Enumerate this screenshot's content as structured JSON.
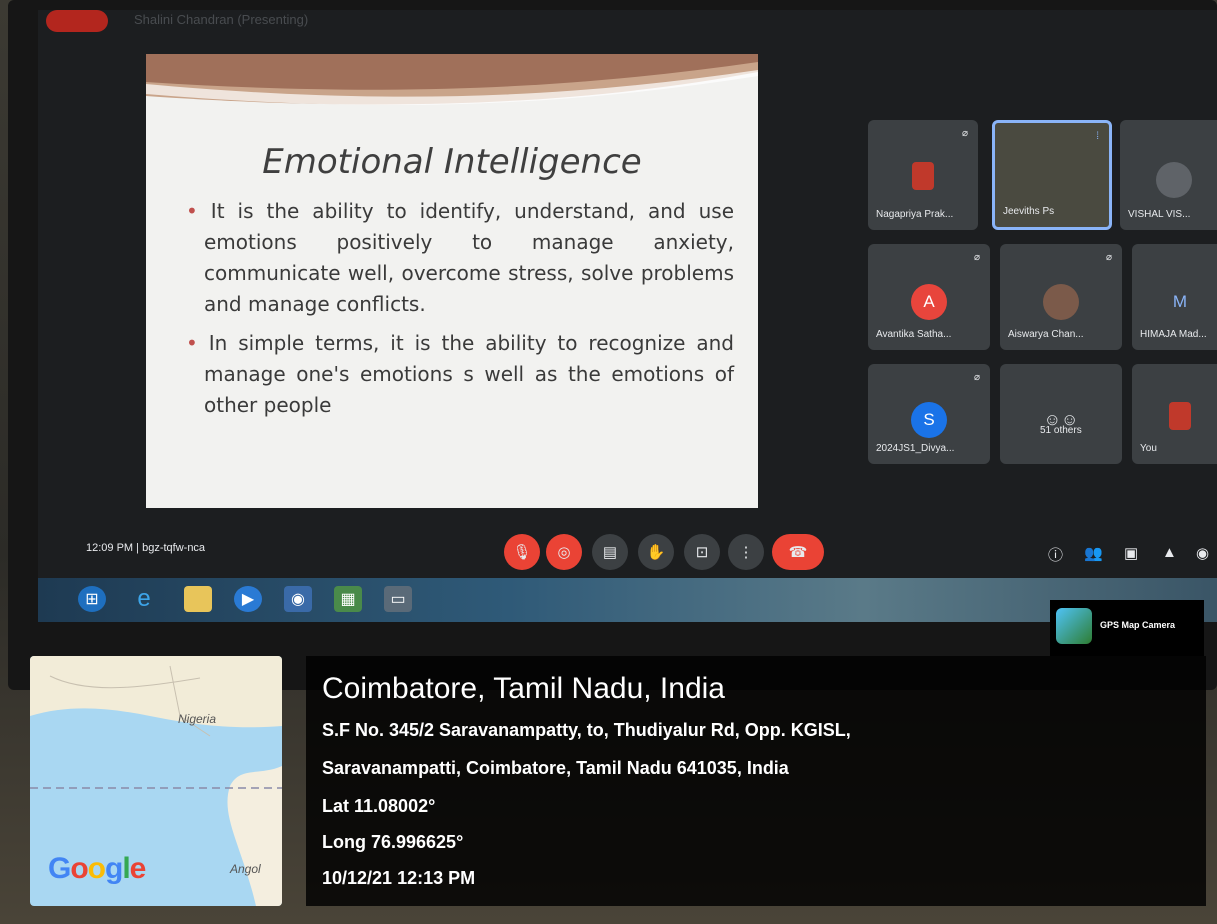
{
  "meet": {
    "rec_label": "REC",
    "presenting_label": "Shalini Chandran (Presenting)",
    "meeting_time": "12:09 PM",
    "meeting_code": "bgz-tqfw-nca",
    "participants": [
      {
        "name": "Nagapriya Prak...",
        "avatar_letter": "",
        "avatar_color": "#c0392b"
      },
      {
        "name": "Jeeviths Ps",
        "avatar_letter": "",
        "avatar_color": "#5f6368"
      },
      {
        "name": "VISHAL VIS...",
        "avatar_letter": "",
        "avatar_color": "#5f6368"
      },
      {
        "name": "Avantika Satha...",
        "avatar_letter": "A",
        "avatar_color": "#e8453c"
      },
      {
        "name": "Aiswarya Chan...",
        "avatar_letter": "",
        "avatar_color": "#7b5a4a"
      },
      {
        "name": "HIMAJA Mad...",
        "avatar_letter": "M",
        "avatar_color": "#5c6bc0"
      },
      {
        "name": "2024JS1_Divya...",
        "avatar_letter": "S",
        "avatar_color": "#1a73e8"
      },
      {
        "name": "51 others",
        "avatar_letter": "",
        "avatar_color": "#5f6368"
      },
      {
        "name": "You",
        "avatar_letter": "",
        "avatar_color": "#c0392b"
      }
    ]
  },
  "slide": {
    "title": "Emotional Intelligence",
    "bullets": [
      "It is the ability to identify, understand, and use emotions positively to manage anxiety, communicate well, overcome stress, solve problems and manage conflicts.",
      "In simple terms, it is the ability to recognize and manage one's emotions s well as the emotions of other people"
    ]
  },
  "gps_overlay": {
    "app_badge": "GPS Map Camera",
    "map_labels": [
      "Nigeria",
      "Angol"
    ],
    "map_brand": "Google",
    "city": "Coimbatore, Tamil Nadu, India",
    "address_line1": "S.F No. 345/2 Saravanampatty, to, Thudiyalur Rd, Opp. KGISL,",
    "address_line2": "Saravanampatti, Coimbatore, Tamil Nadu 641035, India",
    "lat": "Lat 11.08002°",
    "long": "Long 76.996625°",
    "datetime": "10/12/21 12:13 PM"
  },
  "icons": {
    "mic": "mic-off-icon",
    "camera": "camera-off-icon",
    "captions": "captions-icon",
    "raise_hand": "raise-hand-icon",
    "present": "present-icon",
    "more": "more-vert-icon",
    "end_call": "end-call-icon",
    "info": "info-icon",
    "people": "people-icon",
    "chat": "chat-icon",
    "activities": "activities-icon"
  }
}
